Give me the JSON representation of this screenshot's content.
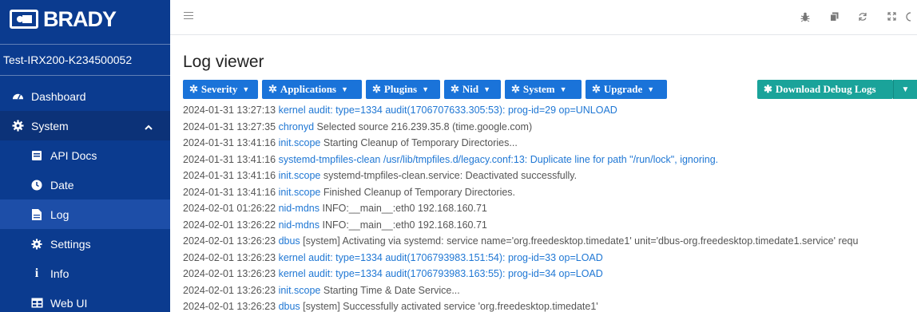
{
  "sidebar": {
    "brand": "BRADY",
    "device_name": "Test-IRX200-K234500052",
    "items": [
      {
        "label": "Dashboard",
        "icon": "dashboard-icon"
      },
      {
        "label": "System",
        "icon": "gear-icon"
      },
      {
        "label": "API Docs",
        "icon": "book-icon"
      },
      {
        "label": "Date",
        "icon": "clock-icon"
      },
      {
        "label": "Log",
        "icon": "file-icon"
      },
      {
        "label": "Settings",
        "icon": "gear-icon"
      },
      {
        "label": "Info",
        "icon": "info-icon"
      },
      {
        "label": "Web UI",
        "icon": "window-icon"
      }
    ]
  },
  "page": {
    "title": "Log viewer"
  },
  "toolbar": {
    "filters": [
      "Severity",
      "Applications",
      "Plugins",
      "Nid",
      "System",
      "Upgrade"
    ],
    "download_label": "Download Debug Logs"
  },
  "log_lines": [
    {
      "time": "2024-01-31 13:27:13",
      "source": "kernel",
      "msg": "audit: type=1334 audit(1706707633.305:53): prog-id=29 op=UNLOAD",
      "msg_link": true
    },
    {
      "time": "2024-01-31 13:27:35",
      "source": "chronyd",
      "msg": "Selected source 216.239.35.8 (time.google.com)",
      "msg_link": false
    },
    {
      "time": "2024-01-31 13:41:16",
      "source": "init.scope",
      "msg": "Starting Cleanup of Temporary Directories...",
      "msg_link": false
    },
    {
      "time": "2024-01-31 13:41:16",
      "source": "systemd-tmpfiles-clean",
      "msg": "/usr/lib/tmpfiles.d/legacy.conf:13: Duplicate line for path \"/run/lock\", ignoring.",
      "msg_link": true
    },
    {
      "time": "2024-01-31 13:41:16",
      "source": "init.scope",
      "msg": "systemd-tmpfiles-clean.service: Deactivated successfully.",
      "msg_link": false
    },
    {
      "time": "2024-01-31 13:41:16",
      "source": "init.scope",
      "msg": "Finished Cleanup of Temporary Directories.",
      "msg_link": false
    },
    {
      "time": "2024-02-01 01:26:22",
      "source": "nid-mdns",
      "msg": "INFO:__main__:eth0 192.168.160.71",
      "msg_link": false
    },
    {
      "time": "2024-02-01 13:26:22",
      "source": "nid-mdns",
      "msg": "INFO:__main__:eth0 192.168.160.71",
      "msg_link": false
    },
    {
      "time": "2024-02-01 13:26:23",
      "source": "dbus",
      "msg": "[system] Activating via systemd: service name='org.freedesktop.timedate1' unit='dbus-org.freedesktop.timedate1.service' requ",
      "msg_link": false
    },
    {
      "time": "2024-02-01 13:26:23",
      "source": "kernel",
      "msg": "audit: type=1334 audit(1706793983.151:54): prog-id=33 op=LOAD",
      "msg_link": true
    },
    {
      "time": "2024-02-01 13:26:23",
      "source": "kernel",
      "msg": "audit: type=1334 audit(1706793983.163:55): prog-id=34 op=LOAD",
      "msg_link": true
    },
    {
      "time": "2024-02-01 13:26:23",
      "source": "init.scope",
      "msg": "Starting Time & Date Service...",
      "msg_link": false
    },
    {
      "time": "2024-02-01 13:26:23",
      "source": "dbus",
      "msg": "[system] Successfully activated service 'org.freedesktop.timedate1'",
      "msg_link": false
    }
  ],
  "colors": {
    "sidebar_bg": "#0b3b8f",
    "button_blue": "#1a73d9",
    "button_teal": "#1aa39a",
    "link_blue": "#1f77d4"
  }
}
